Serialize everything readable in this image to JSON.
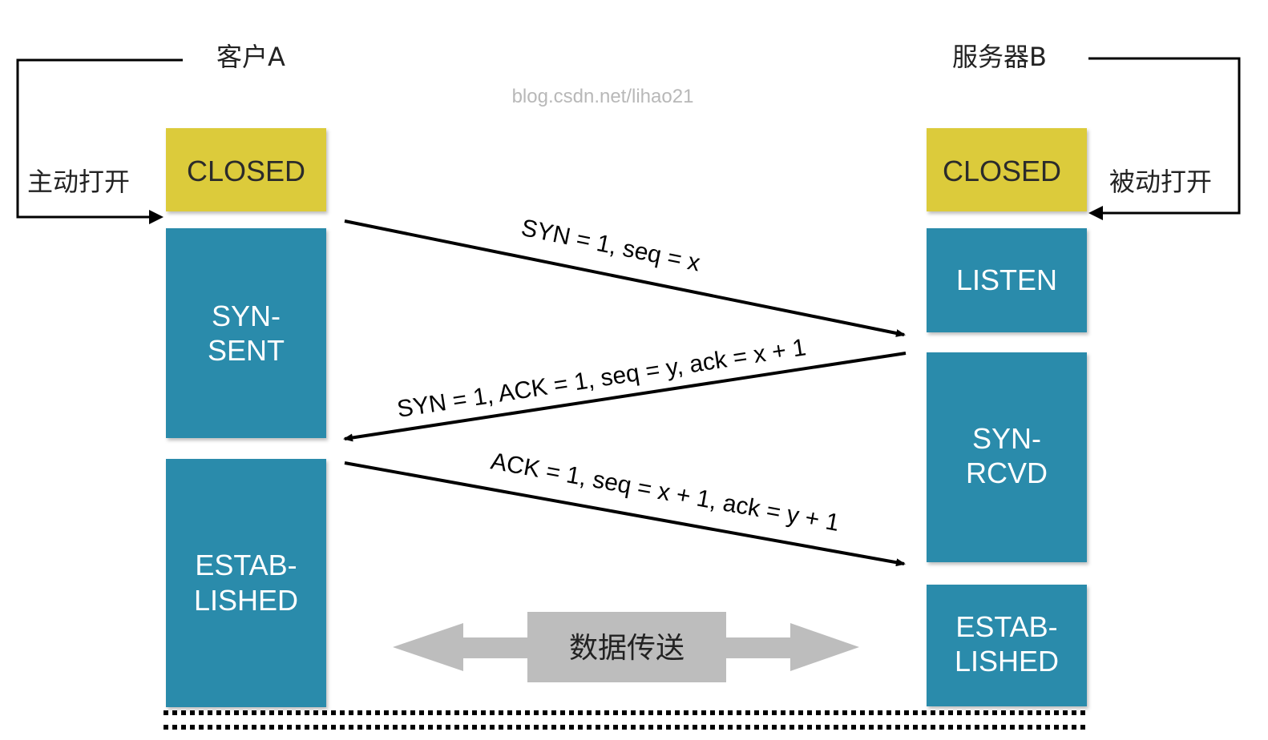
{
  "client": {
    "title": "客户A",
    "open_label": "主动打开",
    "states": {
      "closed": "CLOSED",
      "syn_sent": [
        "SYN-",
        "SENT"
      ],
      "established": [
        "ESTAB-",
        "LISHED"
      ]
    }
  },
  "server": {
    "title": "服务器B",
    "open_label": "被动打开",
    "states": {
      "closed": "CLOSED",
      "listen": "LISTEN",
      "syn_rcvd": [
        "SYN-",
        "RCVD"
      ],
      "established": [
        "ESTAB-",
        "LISHED"
      ]
    }
  },
  "messages": {
    "syn": "SYN = 1, seq = x",
    "syn_ack": "SYN = 1, ACK = 1, seq = y, ack = x + 1",
    "ack": "ACK = 1, seq = x + 1, ack = y + 1"
  },
  "data_transfer": "数据传送",
  "watermark": "blog.csdn.net/lihao21",
  "colors": {
    "closed_fill": "#dccb3a",
    "state_fill": "#2c8bab",
    "arrow": "#000000",
    "transfer_arrow": "#bdbdbd"
  }
}
